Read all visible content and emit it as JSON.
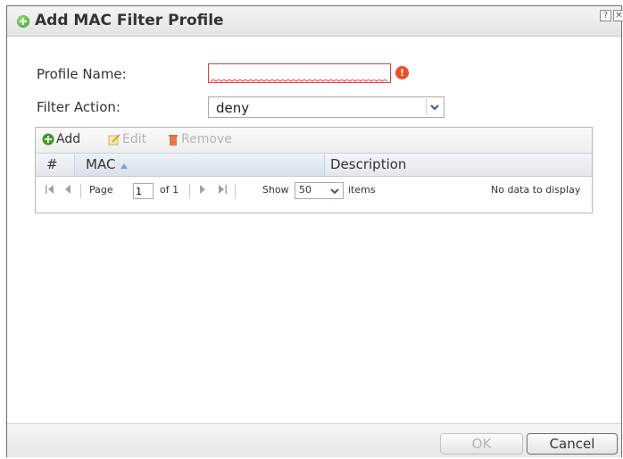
{
  "dialog": {
    "title": "Add MAC Filter Profile",
    "help_glyph": "?",
    "close_glyph": "✕"
  },
  "form": {
    "profile_name_label": "Profile Name:",
    "profile_name_value": "",
    "filter_action_label": "Filter Action:",
    "filter_action_value": "deny"
  },
  "toolbar": {
    "add_label": "Add",
    "edit_label": "Edit",
    "remove_label": "Remove"
  },
  "table": {
    "columns": [
      "#",
      "MAC",
      "Description"
    ],
    "sorted_column": "MAC",
    "sort_direction": "ascending",
    "rows": []
  },
  "pager": {
    "page_label": "Page",
    "page_value": "1",
    "of_label": "of 1",
    "show_label": "Show",
    "show_value": "50",
    "items_label": "items",
    "empty_message": "No data to display"
  },
  "footer": {
    "ok_label": "OK",
    "cancel_label": "Cancel"
  },
  "colors": {
    "error": "#e8502a",
    "accent_green": "#3a9a25",
    "disabled_text": "#b5b5b5"
  }
}
